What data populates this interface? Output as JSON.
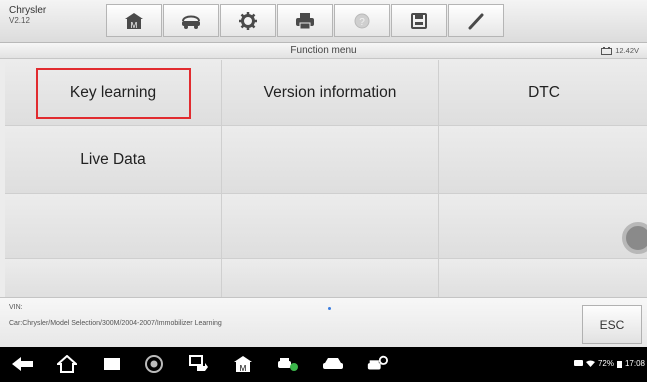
{
  "app": {
    "title": "Chrysler",
    "version": "V2.12"
  },
  "toolbar": {
    "buttons": [
      {
        "name": "home-icon"
      },
      {
        "name": "vehicle-swap-icon"
      },
      {
        "name": "settings-gear-icon"
      },
      {
        "name": "print-icon"
      },
      {
        "name": "help-icon",
        "disabled": true
      },
      {
        "name": "save-icon"
      },
      {
        "name": "edit-pen-icon"
      }
    ]
  },
  "subheader": {
    "title": "Function menu",
    "voltage": "12.42V"
  },
  "grid": {
    "rows": [
      [
        "Key learning",
        "Version information",
        "DTC"
      ],
      [
        "Live Data",
        "",
        ""
      ],
      [
        "",
        "",
        ""
      ],
      [
        "",
        "",
        ""
      ]
    ]
  },
  "footer": {
    "vin_label": "VIN:",
    "path": "Car:Chrysler/Model Selection/300M/2004-2007/Immobilizer Learning",
    "esc_label": "ESC"
  },
  "navbar": {
    "icons": [
      "back-icon",
      "home-icon",
      "recents-icon",
      "chrome-icon",
      "remote-icon",
      "maxi-home-icon",
      "car-diag-icon",
      "car-icon",
      "car-service-icon"
    ]
  },
  "status": {
    "battery": "72%",
    "time": "17:08"
  },
  "colors": {
    "highlight": "#e12b2f",
    "navbar": "#000000"
  }
}
